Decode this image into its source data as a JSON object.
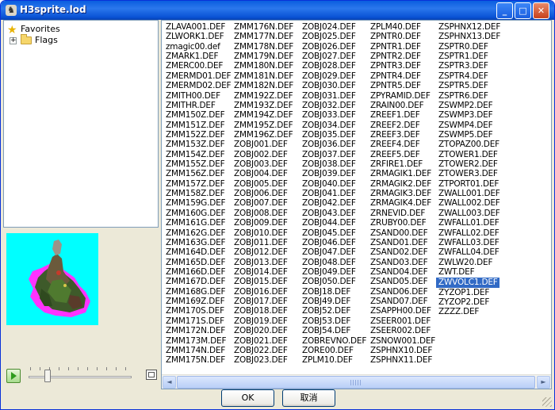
{
  "window": {
    "title": "H3sprite.lod",
    "minimize": "_",
    "maximize": "□",
    "close": "✕",
    "app_icon": "app-icon"
  },
  "tree": {
    "items": [
      {
        "label": "Favorites",
        "icon": "star-icon"
      },
      {
        "label": "Flags",
        "icon": "folder-icon",
        "expander": "+"
      }
    ]
  },
  "preview": {
    "description_icon": "sprite-preview"
  },
  "player": {
    "slider_value": 0.15
  },
  "files": {
    "columns": [
      [
        "ZLAVA001.DEF",
        "ZLWORK1.DEF",
        "zmagic00.def",
        "ZMARK1.DEF",
        "ZMERC00.DEF",
        "ZMERMD01.DEF",
        "ZMERMD02.DEF",
        "ZMITH00.DEF",
        "ZMITHR.DEF",
        "ZMM150Z.DEF",
        "ZMM151Z.DEF",
        "ZMM152Z.DEF",
        "ZMM153Z.DEF",
        "ZMM154Z.DEF",
        "ZMM155Z.DEF",
        "ZMM156Z.DEF",
        "ZMM157Z.DEF",
        "ZMM158Z.DEF",
        "ZMM159G.DEF",
        "ZMM160G.DEF",
        "ZMM161G.DEF",
        "ZMM162G.DEF",
        "ZMM163G.DEF",
        "ZMM164D.DEF",
        "ZMM165D.DEF",
        "ZMM166D.DEF",
        "ZMM167D.DEF",
        "ZMM168G.DEF",
        "ZMM169Z.DEF",
        "ZMM170S.DEF",
        "ZMM171S.DEF",
        "ZMM172N.DEF",
        "ZMM173M.DEF",
        "ZMM174N.DEF",
        "ZMM175N.DEF"
      ],
      [
        "ZMM176N.DEF",
        "ZMM177N.DEF",
        "ZMM178N.DEF",
        "ZMM179N.DEF",
        "ZMM180N.DEF",
        "ZMM181N.DEF",
        "ZMM182N.DEF",
        "ZMM192Z.DEF",
        "ZMM193Z.DEF",
        "ZMM194Z.DEF",
        "ZMM195Z.DEF",
        "ZMM196Z.DEF",
        "ZOBJ001.DEF",
        "ZOBJ002.DEF",
        "ZOBJ003.DEF",
        "ZOBJ004.DEF",
        "ZOBJ005.DEF",
        "ZOBJ006.DEF",
        "ZOBJ007.DEF",
        "ZOBJ008.DEF",
        "ZOBJ009.DEF",
        "ZOBJ010.DEF",
        "ZOBJ011.DEF",
        "ZOBJ012.DEF",
        "ZOBJ013.DEF",
        "ZOBJ014.DEF",
        "ZOBJ015.DEF",
        "ZOBJ016.DEF",
        "ZOBJ017.DEF",
        "ZOBJ018.DEF",
        "ZOBJ019.DEF",
        "ZOBJ020.DEF",
        "ZOBJ021.DEF",
        "ZOBJ022.DEF",
        "ZOBJ023.DEF"
      ],
      [
        "ZOBJ024.DEF",
        "ZOBJ025.DEF",
        "ZOBJ026.DEF",
        "ZOBJ027.DEF",
        "ZOBJ028.DEF",
        "ZOBJ029.DEF",
        "ZOBJ030.DEF",
        "ZOBJ031.DEF",
        "ZOBJ032.DEF",
        "ZOBJ033.DEF",
        "ZOBJ034.DEF",
        "ZOBJ035.DEF",
        "ZOBJ036.DEF",
        "ZOBJ037.DEF",
        "ZOBJ038.DEF",
        "ZOBJ039.DEF",
        "ZOBJ040.DEF",
        "ZOBJ041.DEF",
        "ZOBJ042.DEF",
        "ZOBJ043.DEF",
        "ZOBJ044.DEF",
        "ZOBJ045.DEF",
        "ZOBJ046.DEF",
        "ZOBJ047.DEF",
        "ZOBJ048.DEF",
        "ZOBJ049.DEF",
        "ZOBJ050.DEF",
        "ZOBJ18.DEF",
        "ZOBJ49.DEF",
        "ZOBJ52.DEF",
        "ZOBJ53.DEF",
        "ZOBJ54.DEF",
        "ZOBREVNO.DEF",
        "ZORE00.DEF",
        "ZPLM10.DEF"
      ],
      [
        "ZPLM40.DEF",
        "ZPNTR0.DEF",
        "ZPNTR1.DEF",
        "ZPNTR2.DEF",
        "ZPNTR3.DEF",
        "ZPNTR4.DEF",
        "ZPNTR5.DEF",
        "ZPYRAMID.DEF",
        "ZRAIN00.DEF",
        "ZREEF1.DEF",
        "ZREEF2.DEF",
        "ZREEF3.DEF",
        "ZREEF4.DEF",
        "ZREEF5.DEF",
        "ZRFIRE1.DEF",
        "ZRMAGIK1.DEF",
        "ZRMAGIK2.DEF",
        "ZRMAGIK3.DEF",
        "ZRMAGIK4.DEF",
        "ZRNEVID.DEF",
        "ZRUBY00.DEF",
        "ZSAND00.DEF",
        "ZSAND01.DEF",
        "ZSAND02.DEF",
        "ZSAND03.DEF",
        "ZSAND04.DEF",
        "ZSAND05.DEF",
        "ZSAND06.DEF",
        "ZSAND07.DEF",
        "ZSAPPH00.DEF",
        "ZSEER001.DEF",
        "ZSEER002.DEF",
        "ZSNOW001.DEF",
        "ZSPHNX10.DEF",
        "ZSPHNX11.DEF"
      ],
      [
        "ZSPHNX12.DEF",
        "ZSPHNX13.DEF",
        "ZSPTR0.DEF",
        "ZSPTR1.DEF",
        "ZSPTR3.DEF",
        "ZSPTR4.DEF",
        "ZSPTR5.DEF",
        "ZSPTR6.DEF",
        "ZSWMP2.DEF",
        "ZSWMP3.DEF",
        "ZSWMP4.DEF",
        "ZSWMP5.DEF",
        "ZTOPAZ00.DEF",
        "ZTOWER1.DEF",
        "ZTOWER2.DEF",
        "ZTOWER3.DEF",
        "ZTPORT01.DEF",
        "ZWALL001.DEF",
        "ZWALL002.DEF",
        "ZWALL003.DEF",
        "ZWFALL01.DEF",
        "ZWFALL02.DEF",
        "ZWFALL03.DEF",
        "ZWFALL04.DEF",
        "ZWLW20.DEF",
        "ZWT.DEF",
        "ZWVOLC1.DEF",
        "ZYZOP1.DEF",
        "ZYZOP2.DEF",
        "ZZZZ.DEF"
      ]
    ],
    "selected": "ZWVOLC1.DEF"
  },
  "scrollbar": {
    "left_arrow": "◄",
    "right_arrow": "►"
  },
  "buttons": {
    "ok": "OK",
    "cancel": "取消"
  },
  "colors": {
    "titlebar": "#0a5ddf",
    "selection": "#316ac5",
    "preview_bg": "#00ffff"
  }
}
